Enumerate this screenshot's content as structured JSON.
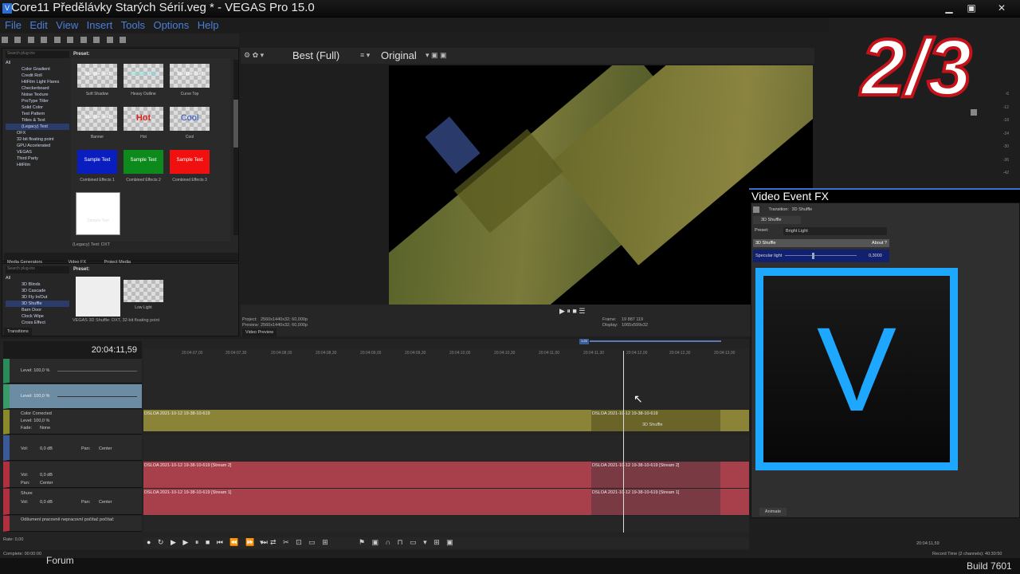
{
  "window": {
    "title": "Core11 Předělávky Starých Sérií.veg * - VEGAS Pro 15.0",
    "icon": "V"
  },
  "menu": [
    "File",
    "Edit",
    "View",
    "Insert",
    "Tools",
    "Options",
    "Help"
  ],
  "media_gen": {
    "search_placeholder": "Search plug-ins",
    "tree": [
      "All",
      "Color Gradient",
      "Credit Roll",
      "HitFilm Light Flares",
      "Checkerboard",
      "Noise Texture",
      "ProType Titler",
      "Solid Color",
      "Test Pattern",
      "Titles & Text",
      "(Legacy) Text",
      "OFX",
      "32-bit floating point",
      "GPU Accelerated",
      "VEGAS",
      "Third Party",
      "HitFilm"
    ],
    "preset_label": "Preset:",
    "presets": [
      {
        "name": "Soft Shadow",
        "text": "Sample Text"
      },
      {
        "name": "Heavy Outline",
        "text": "Sample Text"
      },
      {
        "name": "Curve Top",
        "text": "Sample Text"
      },
      {
        "name": "Banner",
        "text": "Sample Text"
      },
      {
        "name": "Hot",
        "text": "Hot"
      },
      {
        "name": "Cool",
        "text": "Cool"
      },
      {
        "name": "Combined Effects 1",
        "text": "Sample Text"
      },
      {
        "name": "Combined Effects 2",
        "text": "Sample Text"
      },
      {
        "name": "Combined Effects 3",
        "text": "Sample Text"
      },
      {
        "name": "",
        "text": "Sample Text"
      }
    ],
    "footer": "(Legacy) Text: DXT",
    "tabs": [
      "Media Generators",
      "Video FX",
      "Project Media"
    ]
  },
  "transitions": {
    "search_placeholder": "Search plug-ins",
    "tree": [
      "All",
      "3D Blinds",
      "3D Cascade",
      "3D Fly In/Out",
      "3D Shuffle",
      "Barn Door",
      "Clock Wipe",
      "Cross Effect"
    ],
    "preset_label": "Preset:",
    "presets": [
      "",
      "Low Light"
    ],
    "footer": "VEGAS 3D Shuffle: DXT, 32-bit floating point",
    "tab": "Transitions"
  },
  "preview": {
    "quality": "Best (Full)",
    "zoom": "Original",
    "project": "Project:",
    "project_val": "2560x1440x32; 60,000p",
    "preview": "Preview:",
    "preview_val": "2560x1440x32; 60,000p",
    "frame": "Frame:",
    "frame_val": "19 887 119",
    "display": "Display:",
    "display_val": "1065x599x32",
    "tab": "Video Preview"
  },
  "timeline": {
    "timecode": "20:04:11,59",
    "loop_region": "1:20",
    "ruler": [
      "20:04:07,00",
      "20:04:07,30",
      "20:04:08,00",
      "20:04:08,30",
      "20:04:09,00",
      "20:04:09,30",
      "20:04:10,00",
      "20:04:10,30",
      "20:04:11,00",
      "20:04:11,30",
      "20:04:12,00",
      "20:04:12,30",
      "20:04:13,00"
    ],
    "tracks": [
      {
        "label": "Level: 100,0 %"
      },
      {
        "label": "Level: 100,0 %"
      },
      {
        "name": "Color Corrected",
        "label": "Level: 100,0 %",
        "fade": "Fade:",
        "fade_val": "None"
      },
      {
        "label": "Vol:",
        "vol": "0,0 dB",
        "pan": "Pan:",
        "pan_val": "Center"
      },
      {
        "label": "Vol:",
        "vol": "0,0 dB",
        "pan": "Pan:",
        "pan_val": "Center"
      },
      {
        "name": "Shure",
        "label": "Vol:",
        "vol": "0,0 dB",
        "pan": "Pan:",
        "pan_val": "Center"
      },
      {
        "name": "Odšumení pracovně nepracovní počítač počítač"
      }
    ],
    "clips": {
      "video": "DSLOA 2021-10-12 19-38-10-619",
      "video2": "DSLOA 2021-10-12 19-38-10-619",
      "transition": "3D Shuffle",
      "audio1": "DSLOA 2021-10-12 19-38-10-619 [Stream 2]",
      "audio1b": "DSLOA 2021-10-12 19-38-10-619 [Stream 2]",
      "audio2": "DSLOA 2021-10-12 19-38-10-619 [Stream 1]",
      "audio2b": "DSLOA 2021-10-12 19-38-10-619 [Stream 1]"
    },
    "rate": "Rate: 0,00"
  },
  "vefx": {
    "title": "Video Event FX",
    "transition": "Transition:",
    "transition_val": "3D Shuffle",
    "fx_name": "3D Shuffle",
    "preset": "Preset:",
    "preset_val": "Bright Light",
    "plugin": "3D Shuffle",
    "about": "About ?",
    "param": "Specular light",
    "param_val": "0,3000",
    "animate": "Animate"
  },
  "meter": [
    "-6",
    "-12",
    "-18",
    "-24",
    "-30",
    "-36",
    "-42"
  ],
  "status": {
    "complete": "Complete: 00:00:00",
    "record": "Record Time (2 channels): 40:30:50",
    "time": "20:04:11,59"
  },
  "bottom": {
    "forum": "Forum",
    "build": "Build 7601"
  },
  "overlay": "2/3",
  "vegas_logo": "V"
}
